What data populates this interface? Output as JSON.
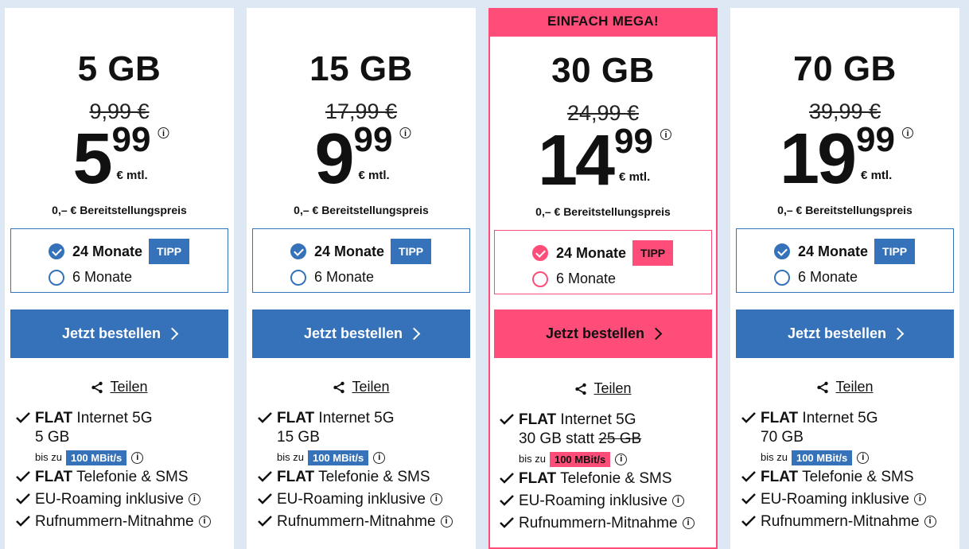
{
  "colors": {
    "blue": "#3672b9",
    "pink": "#ff4d79",
    "background": "#dde8f4"
  },
  "plans": [
    {
      "gb": "5 GB",
      "old_price": "9,99 €",
      "price_int": "5",
      "price_dec": "99",
      "price_unit": "€ mtl.",
      "setup": "0,– € Bereitstellungspreis",
      "term1": "24 Monate",
      "tipp": "TIPP",
      "term2": "6 Monate",
      "cta": "Jetzt bestellen",
      "share": "Teilen",
      "f1_bold": "FLAT",
      "f1_rest": " Internet 5G",
      "volume": "5 GB",
      "speed_prefix": "bis zu",
      "speed": "100 MBit/s",
      "f2_bold": "FLAT",
      "f2_rest": " Telefonie & SMS",
      "f3": "EU-Roaming inklusive",
      "f4": "Rufnummern-Mitnahme"
    },
    {
      "gb": "15 GB",
      "old_price": "17,99 €",
      "price_int": "9",
      "price_dec": "99",
      "price_unit": "€ mtl.",
      "setup": "0,– € Bereitstellungspreis",
      "term1": "24 Monate",
      "tipp": "TIPP",
      "term2": "6 Monate",
      "cta": "Jetzt bestellen",
      "share": "Teilen",
      "f1_bold": "FLAT",
      "f1_rest": " Internet 5G",
      "volume": "15 GB",
      "speed_prefix": "bis zu",
      "speed": "100 MBit/s",
      "f2_bold": "FLAT",
      "f2_rest": " Telefonie & SMS",
      "f3": "EU-Roaming inklusive",
      "f4": "Rufnummern-Mitnahme"
    },
    {
      "badge": "EINFACH MEGA!",
      "gb": "30 GB",
      "old_price": "24,99 €",
      "price_int": "14",
      "price_dec": "99",
      "price_unit": "€ mtl.",
      "setup": "0,– € Bereitstellungspreis",
      "term1": "24 Monate",
      "tipp": "TIPP",
      "term2": "6 Monate",
      "cta": "Jetzt bestellen",
      "share": "Teilen",
      "f1_bold": "FLAT",
      "f1_rest": " Internet 5G",
      "volume": "30 GB statt ",
      "volume_old": "25 GB",
      "speed_prefix": "bis zu",
      "speed": "100 MBit/s",
      "f2_bold": "FLAT",
      "f2_rest": " Telefonie & SMS",
      "f3": "EU-Roaming inklusive",
      "f4": "Rufnummern-Mitnahme"
    },
    {
      "gb": "70 GB",
      "old_price": "39,99 €",
      "price_int": "19",
      "price_dec": "99",
      "price_unit": "€ mtl.",
      "setup": "0,– € Bereitstellungspreis",
      "term1": "24 Monate",
      "tipp": "TIPP",
      "term2": "6 Monate",
      "cta": "Jetzt bestellen",
      "share": "Teilen",
      "f1_bold": "FLAT",
      "f1_rest": " Internet 5G",
      "volume": "70 GB",
      "speed_prefix": "bis zu",
      "speed": "100 MBit/s",
      "f2_bold": "FLAT",
      "f2_rest": " Telefonie & SMS",
      "f3": "EU-Roaming inklusive",
      "f4": "Rufnummern-Mitnahme"
    }
  ]
}
